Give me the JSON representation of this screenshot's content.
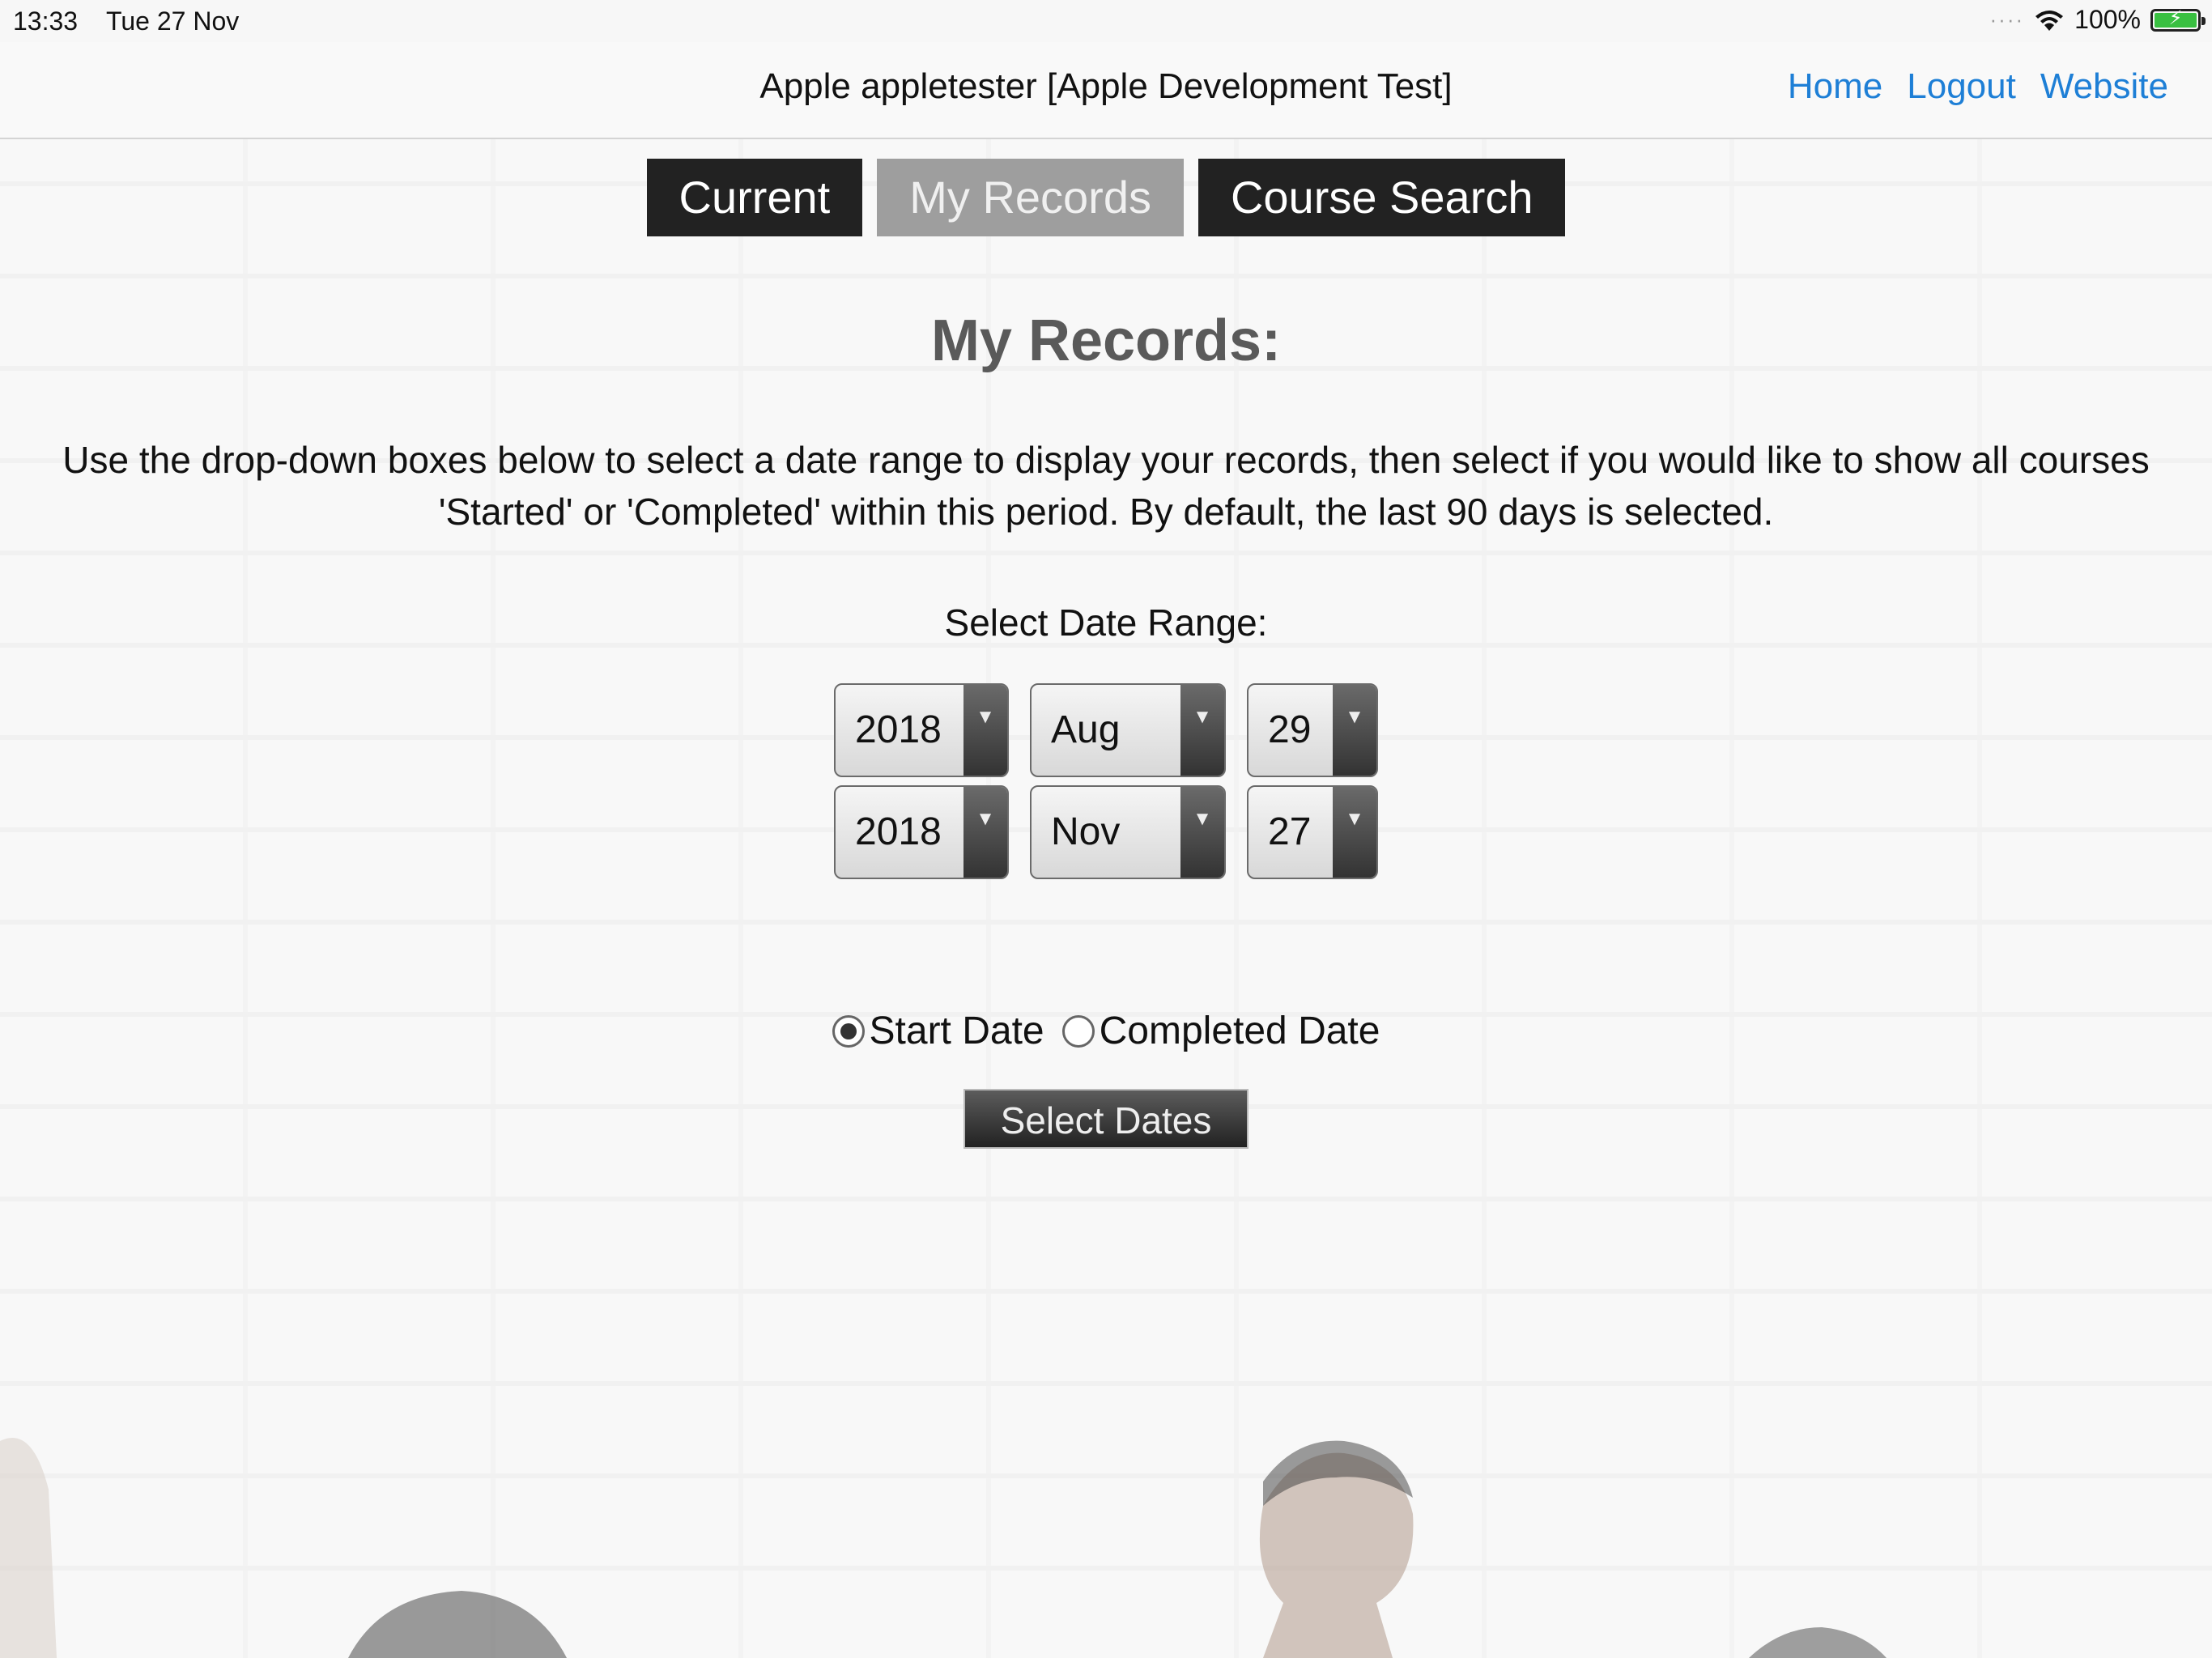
{
  "status_bar": {
    "time": "13:33",
    "date": "Tue 27 Nov",
    "battery": "100%",
    "battery_level": 1.0
  },
  "header": {
    "title": "Apple appletester [Apple Development Test]",
    "links": [
      "Home",
      "Logout",
      "Website"
    ]
  },
  "tabs": [
    {
      "label": "Current",
      "active": false
    },
    {
      "label": "My Records",
      "active": true
    },
    {
      "label": "Course Search",
      "active": false
    }
  ],
  "main": {
    "title": "My Records:",
    "description": "Use the drop-down boxes below to select a date range to display your records, then select if you would like to show all courses 'Started' or 'Completed' within this period. By default, the last 90 days is selected.",
    "range_label": "Select Date Range:",
    "from": {
      "year": "2018",
      "month": "Aug",
      "day": "29"
    },
    "to": {
      "year": "2018",
      "month": "Nov",
      "day": "27"
    },
    "radio_start": "Start Date",
    "radio_completed": "Completed Date",
    "selected_radio": "start",
    "submit_label": "Select Dates"
  },
  "colors": {
    "link": "#1e7fd6",
    "tab_dark": "#222222",
    "tab_active": "#9e9e9e"
  },
  "icons": {
    "wifi": "wifi-icon",
    "battery": "battery-icon",
    "dropdown": "chevron-down-icon"
  }
}
